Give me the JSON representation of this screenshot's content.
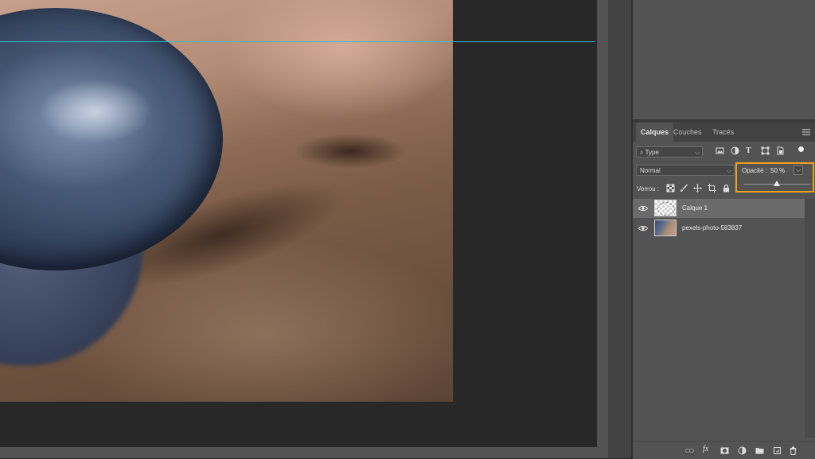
{
  "panel": {
    "tabs": [
      {
        "label": "Calques",
        "active": true
      },
      {
        "label": "Couches",
        "active": false
      },
      {
        "label": "Tracés",
        "active": false
      }
    ],
    "filter_type": "Type",
    "blend_mode": "Normal",
    "opacity_label": "Opacité :",
    "opacity_value": "50 %",
    "opacity_fraction": 0.5,
    "lock_label": "Verrou :",
    "layers": [
      {
        "name": "Calque 1",
        "selected": true,
        "visible": true,
        "thumb": "checkerboard-transparent"
      },
      {
        "name": "pexels-photo-583837",
        "selected": false,
        "visible": true,
        "thumb": "photo"
      }
    ],
    "filter_icons": [
      "image-filter-icon",
      "adjustment-filter-icon",
      "type-filter-icon",
      "shape-filter-icon",
      "smartobject-filter-icon",
      "filter-toggle-icon"
    ],
    "lock_icons": [
      "lock-transparent-icon",
      "lock-paint-icon",
      "lock-position-icon",
      "lock-artboard-icon",
      "lock-all-icon"
    ],
    "bottom_icons": [
      "link-layers-icon",
      "fx-icon",
      "mask-icon",
      "adjustment-layer-icon",
      "new-group-icon",
      "new-layer-icon",
      "delete-icon"
    ]
  },
  "colors": {
    "highlight": "#f0a11c",
    "guide": "#2ec3c7",
    "panel_bg": "#535353",
    "canvas_bg": "#282828"
  }
}
